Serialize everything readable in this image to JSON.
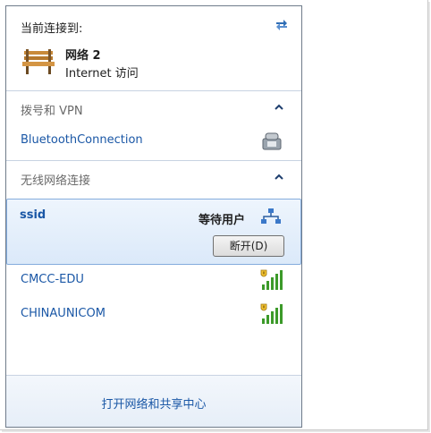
{
  "header": {
    "label": "当前连接到:",
    "refresh_icon": "refresh-arrows-icon",
    "network_icon": "park-bench-icon",
    "network_name": "网络  2",
    "network_access": "Internet 访问"
  },
  "dialup_section": {
    "title": "拨号和 VPN",
    "toggle_icon": "chevron-up-icon",
    "items": [
      {
        "label": "BluetoothConnection",
        "icon": "phone-icon"
      }
    ]
  },
  "wireless_section": {
    "title": "无线网络连接",
    "toggle_icon": "chevron-up-icon",
    "selected": {
      "ssid": "ssid",
      "status": "等待用户",
      "status_icon": "connecting-network-icon",
      "button_label": "断开(D)"
    },
    "networks": [
      {
        "name": "CMCC-EDU",
        "icon": "wifi-signal-secured-icon"
      },
      {
        "name": "CHINAUNICOM",
        "icon": "wifi-signal-secured-icon"
      }
    ]
  },
  "footer": {
    "link": "打开网络和共享中心"
  },
  "colors": {
    "link": "#1a57a6",
    "section_title": "#6a6a6a",
    "selected_bg": "#dbe9f9",
    "selected_border": "#84acdd",
    "signal_green": "#3c9a2a",
    "shield_yellow": "#f2c230"
  }
}
